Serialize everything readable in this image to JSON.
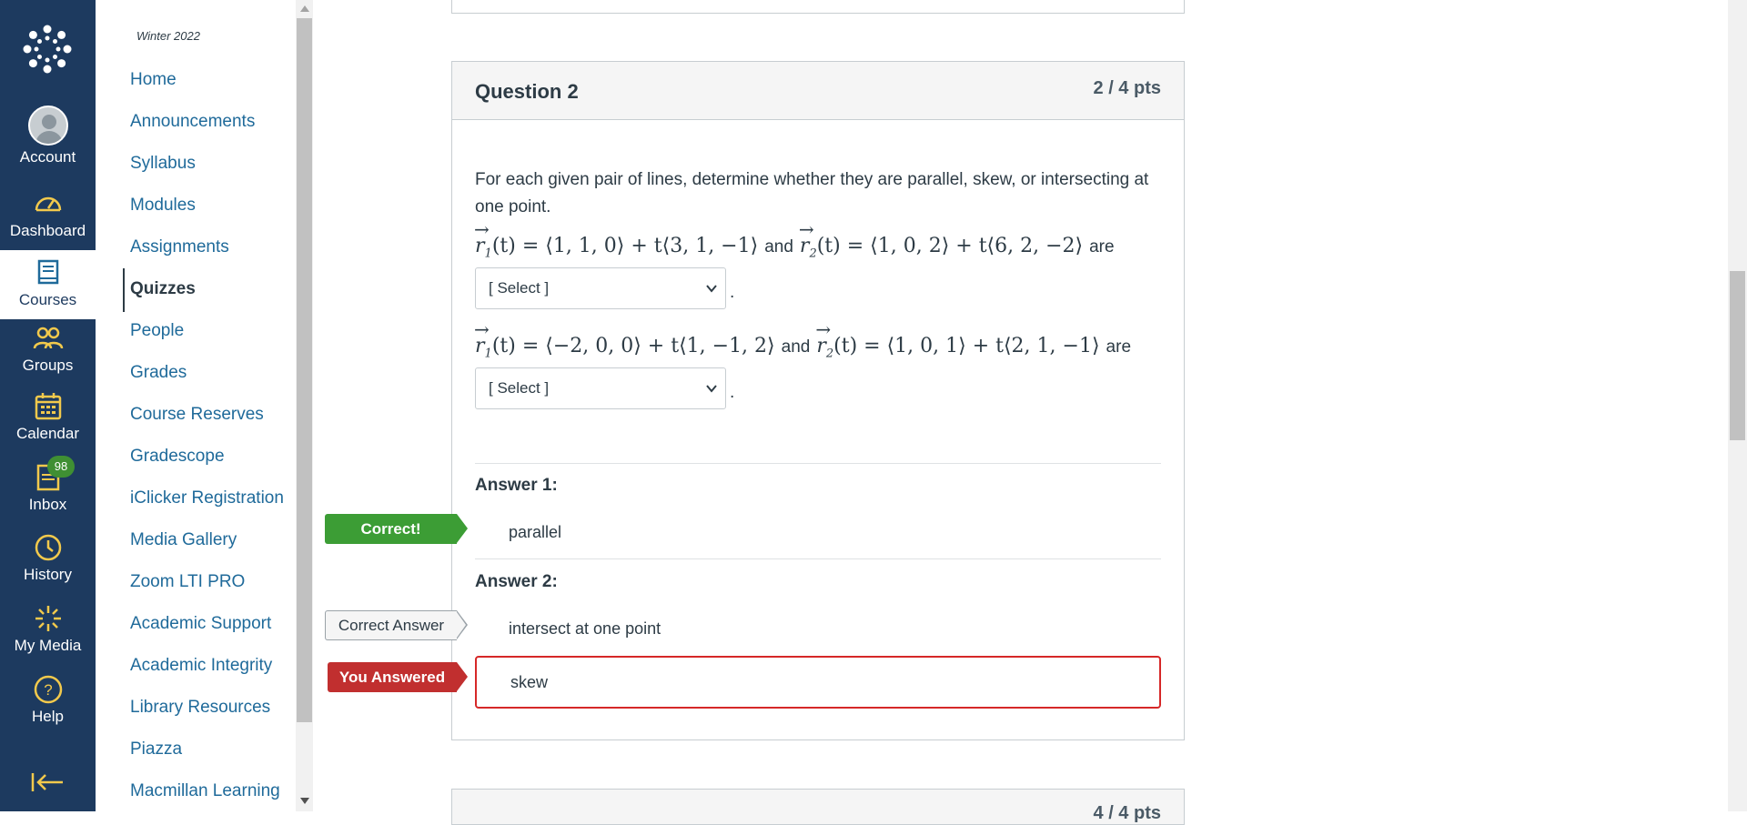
{
  "global_nav": {
    "items": [
      {
        "label": "Account",
        "icon": "account-avatar"
      },
      {
        "label": "Dashboard",
        "icon": "dashboard-icon"
      },
      {
        "label": "Courses",
        "icon": "courses-icon",
        "active": true
      },
      {
        "label": "Groups",
        "icon": "groups-icon"
      },
      {
        "label": "Calendar",
        "icon": "calendar-icon"
      },
      {
        "label": "Inbox",
        "icon": "inbox-icon",
        "badge": "98"
      },
      {
        "label": "History",
        "icon": "history-icon"
      },
      {
        "label": "My Media",
        "icon": "my-media-icon"
      },
      {
        "label": "Help",
        "icon": "help-icon"
      }
    ],
    "colors": {
      "background": "#1d3a5f",
      "icon": "#f2c94c",
      "badge": "#3f8f33"
    }
  },
  "course_nav": {
    "term": "Winter 2022",
    "links": [
      "Home",
      "Announcements",
      "Syllabus",
      "Modules",
      "Assignments",
      "Quizzes",
      "People",
      "Grades",
      "Course Reserves",
      "Gradescope",
      "iClicker Registration",
      "Media Gallery",
      "Zoom LTI PRO",
      "Academic Support",
      "Academic Integrity",
      "Library Resources",
      "Piazza",
      "Macmillan Learning"
    ],
    "active": "Quizzes"
  },
  "question": {
    "title": "Question 2",
    "points": "2 / 4 pts",
    "prompt": "For each given pair of lines, determine whether they are parallel, skew, or intersecting at one point.",
    "word_and": "and",
    "word_are": "are",
    "eq1_left": "(t) = ⟨1, 1, 0⟩ + t⟨3, 1, −1⟩",
    "eq1_right": "(t) = ⟨1, 0, 2⟩ + t⟨6, 2, −2⟩",
    "eq2_left": "(t) = ⟨−2, 0, 0⟩ + t⟨1, −1, 2⟩",
    "eq2_right": "(t) = ⟨1, 0, 1⟩ + t⟨2, 1, −1⟩",
    "select_placeholder": "[ Select ]",
    "answer1_label": "Answer 1:",
    "answer1_value": "parallel",
    "answer2_label": "Answer 2:",
    "answer2_correct": "intersect at one point",
    "answer2_given": "skew",
    "tag_correct": "Correct!",
    "tag_correct_answer": "Correct Answer",
    "tag_you_answered": "You Answered"
  },
  "next_question": {
    "points": "4 / 4 pts"
  }
}
